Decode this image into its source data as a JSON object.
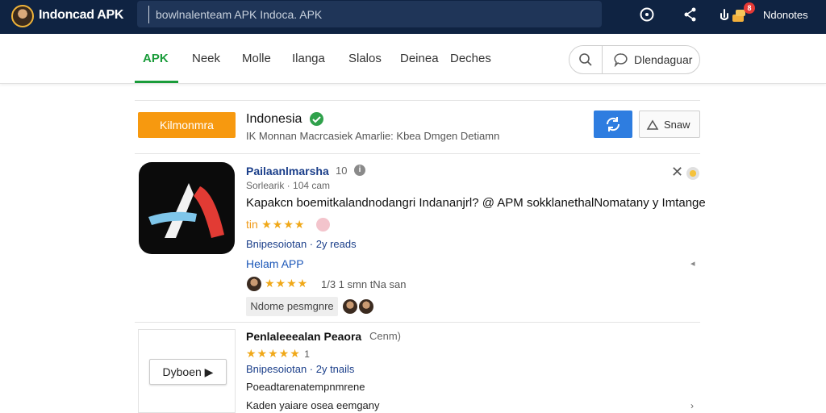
{
  "topbar": {
    "title": "Indoncad APK",
    "search_placeholder": "bowlnalenteam APK Indoca. APK",
    "notification_count": "8",
    "user_name": "Ndonotes"
  },
  "nav": {
    "tabs": [
      "APK",
      "Neek",
      "Molle",
      "Ilanga",
      "Slalos",
      "Deinea",
      "Deches"
    ],
    "download_label": "Dlendaguar"
  },
  "region": {
    "button_label": "Kilmonmra",
    "title": "Indonesia",
    "subtitle": "IK Monnan Macrcasiek Amarlie: Kbea Dmgen Detiamn",
    "share_label": "Snaw"
  },
  "app1": {
    "name": "Pailaanlmarsha",
    "version": "10",
    "developer": "Sorlearik · 104 cam",
    "description": "Kapakcn boemitkalandnodangri Indananjrl? @ APM  sokklanethalNomatany y Imtange",
    "rating_prefix": "tin",
    "meta": "Bnipesoiotan · 2y reads",
    "link": "Helam APP",
    "review": "1/3 1 smn tNa san",
    "tag": "Ndome pesmgnre"
  },
  "app2": {
    "button_label": "Dyboen",
    "name": "Penlaleeealan Peaora",
    "version": "Cenm)",
    "rating_count": "1",
    "meta": "Bnipesoiotan · 2y tnails",
    "line1": "Poeadtarenatempnmrene",
    "line2": "Kaden  yaiare osea eemgany"
  },
  "colors": {
    "topbar": "#0f2342",
    "accent_green": "#1a9c3a",
    "orange": "#f7990f",
    "blue": "#2e7de0",
    "star": "#f0a818"
  }
}
